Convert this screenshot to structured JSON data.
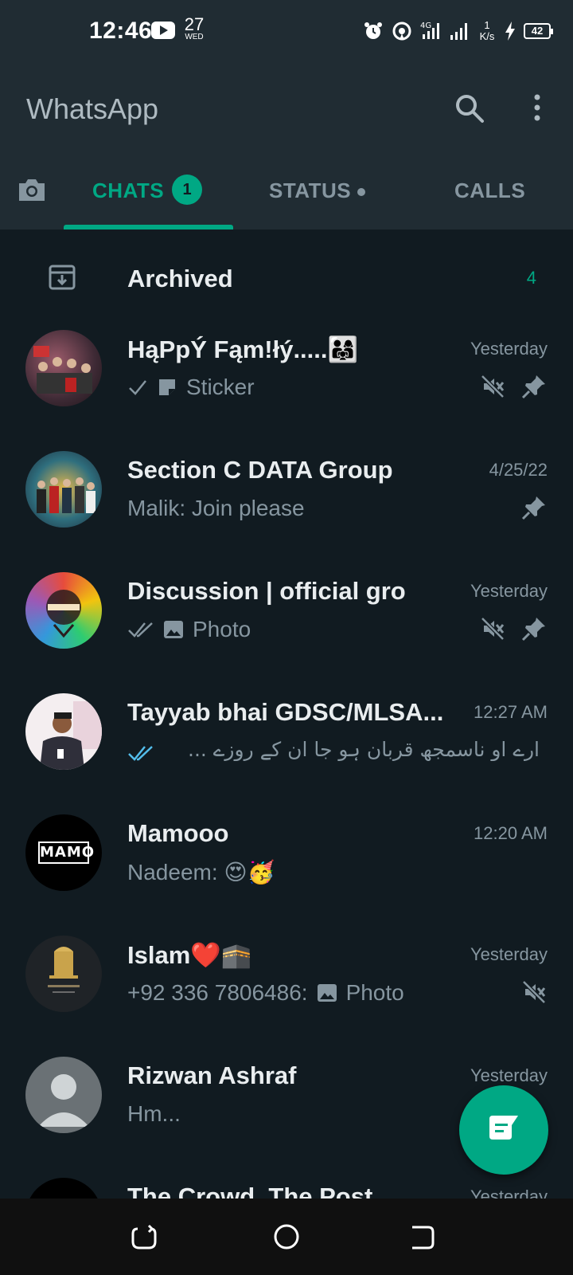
{
  "status_bar": {
    "time": "12:46",
    "date_day": "27",
    "date_weekday": "WED",
    "network": "4G",
    "speed_value": "1",
    "speed_unit": "K/s",
    "battery": "42"
  },
  "app": {
    "title": "WhatsApp",
    "accent_color": "#00a884"
  },
  "tabs": [
    {
      "label": "CHATS",
      "badge": "1",
      "active": true
    },
    {
      "label": "STATUS",
      "has_dot": true
    },
    {
      "label": "CALLS"
    }
  ],
  "archived": {
    "label": "Archived",
    "count": "4"
  },
  "chats": [
    {
      "name": "HąPpÝ Fąm!łý.....👨‍👩‍👧",
      "time": "Yesterday",
      "preview_icon": "sticker-icon",
      "preview": "Sticker",
      "tick": "single-tick",
      "muted": true,
      "pinned": true
    },
    {
      "name": "Section C DATA Group",
      "time": "4/25/22",
      "preview": "Malik: Join please",
      "muted": false,
      "pinned": true
    },
    {
      "name": "Discussion | official gro",
      "time": "Yesterday",
      "preview_icon": "photo-icon",
      "preview": "Photo",
      "tick": "double-tick",
      "muted": true,
      "pinned": true
    },
    {
      "name": "Tayyab bhai GDSC/MLSA...",
      "time": "12:27 AM",
      "preview": "ارے او ناسمجھ قربان ہو جا ان کے روزے ...",
      "tick": "double-tick-blue"
    },
    {
      "name": "Mamooo",
      "time": "12:20 AM",
      "preview": "Nadeem: 😍🥳"
    },
    {
      "name": "Islam❤️🕋",
      "time": "Yesterday",
      "preview_prefix": "+92 336 7806486:",
      "preview_icon": "photo-icon",
      "preview": "Photo",
      "muted": true
    },
    {
      "name": "Rizwan Ashraf",
      "time": "Yesterday",
      "preview": "Hm..."
    },
    {
      "name": "The Crowd, The Post",
      "time": "Yesterday",
      "preview": ""
    }
  ],
  "avatar_text": {
    "mamooo": "MAMO"
  },
  "fab_label": "new-chat"
}
